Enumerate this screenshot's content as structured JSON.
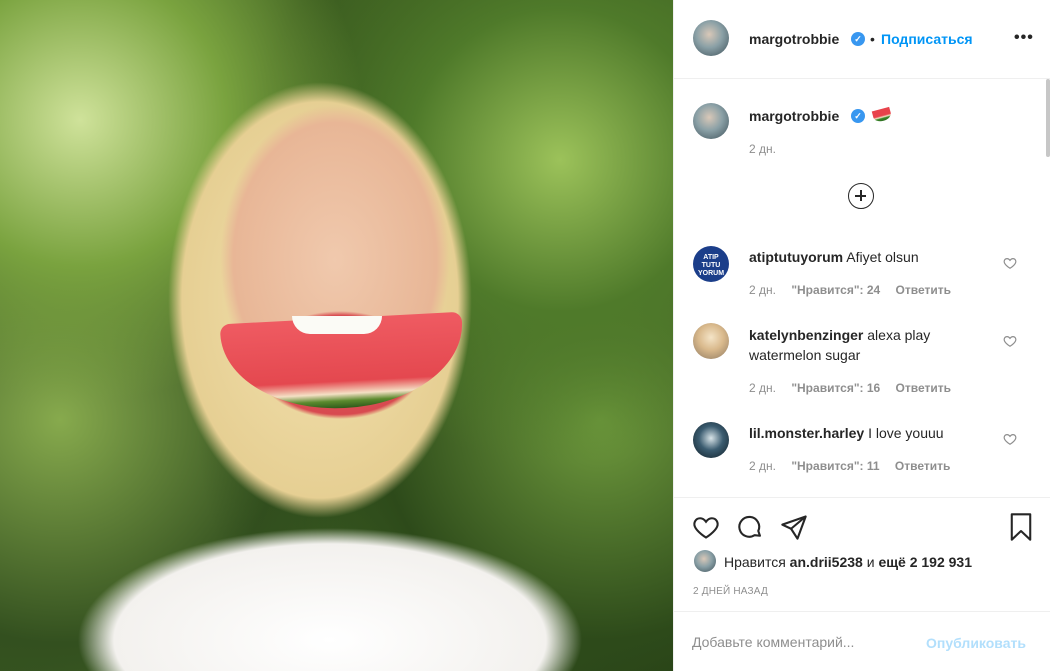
{
  "post": {
    "photo_alt": ""
  },
  "header": {
    "username": "margotrobbie",
    "separator": "•",
    "follow_label": "Подписаться",
    "more_label": "•••"
  },
  "caption": {
    "username": "margotrobbie",
    "emoji": "watermelon",
    "time": "2 дн."
  },
  "comments": [
    {
      "username": "atiptutuyorum",
      "text": "Afiyet olsun",
      "avatar_text": "ATIP TUTU YORUM",
      "time": "2 дн.",
      "likes": "\"Нравится\": 24",
      "reply": "Ответить"
    },
    {
      "username": "katelynbenzinger",
      "text": "alexa play",
      "text2": "watermelon sugar",
      "time": "2 дн.",
      "likes": "\"Нравится\": 16",
      "reply": "Ответить"
    },
    {
      "username": "lil.monster.harley",
      "text": "I love youuu",
      "time": "2 дн.",
      "likes": "\"Нравится\": 11",
      "reply": "Ответить"
    }
  ],
  "actions": {
    "liked_prefix": "Нравится",
    "liked_user": "an.drii5238",
    "liked_and": "и",
    "liked_more": "ещё 2 192 931",
    "date": "2 ДНЕЙ НАЗАД"
  },
  "add_comment": {
    "placeholder": "Добавьте комментарий...",
    "publish_label": "Опубликовать"
  },
  "colors": {
    "accent": "#0095f6",
    "verified": "#3897f0",
    "muted": "#8e8e8e",
    "publish_disabled": "#b2dffc"
  }
}
